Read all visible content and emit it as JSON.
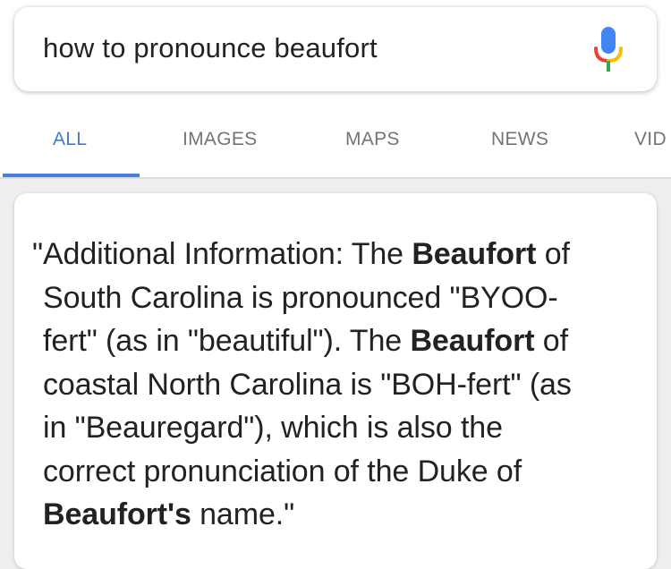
{
  "search": {
    "query": "how to pronounce beaufort",
    "mic_icon": "microphone-icon"
  },
  "tabs": [
    {
      "label": "ALL",
      "active": true
    },
    {
      "label": "IMAGES",
      "active": false
    },
    {
      "label": "MAPS",
      "active": false
    },
    {
      "label": "NEWS",
      "active": false
    },
    {
      "label": "VID",
      "active": false
    }
  ],
  "snippet": {
    "lines": [
      {
        "parts": [
          {
            "t": "\"Additional Information: The "
          },
          {
            "t": "Beaufort",
            "b": true
          },
          {
            "t": " of"
          }
        ]
      },
      {
        "parts": [
          {
            "t": "South Carolina is pronounced \"BYOO-"
          }
        ]
      },
      {
        "parts": [
          {
            "t": "fert\" (as in \"beautiful\"). The "
          },
          {
            "t": "Beaufort",
            "b": true
          },
          {
            "t": " of"
          }
        ]
      },
      {
        "parts": [
          {
            "t": "coastal North Carolina is \"BOH-fert\" (as"
          }
        ]
      },
      {
        "parts": [
          {
            "t": "in \"Beauregard\"), which is also the"
          }
        ]
      },
      {
        "parts": [
          {
            "t": "correct pronunciation of the Duke of"
          }
        ]
      },
      {
        "parts": [
          {
            "t": "Beaufort's",
            "b": true
          },
          {
            "t": " name.\""
          }
        ]
      }
    ]
  },
  "colors": {
    "active_tab": "#4679d4",
    "mic_blue": "#4285f4",
    "mic_red": "#ea4335",
    "mic_yellow": "#fbbc05",
    "mic_green": "#34a853"
  }
}
